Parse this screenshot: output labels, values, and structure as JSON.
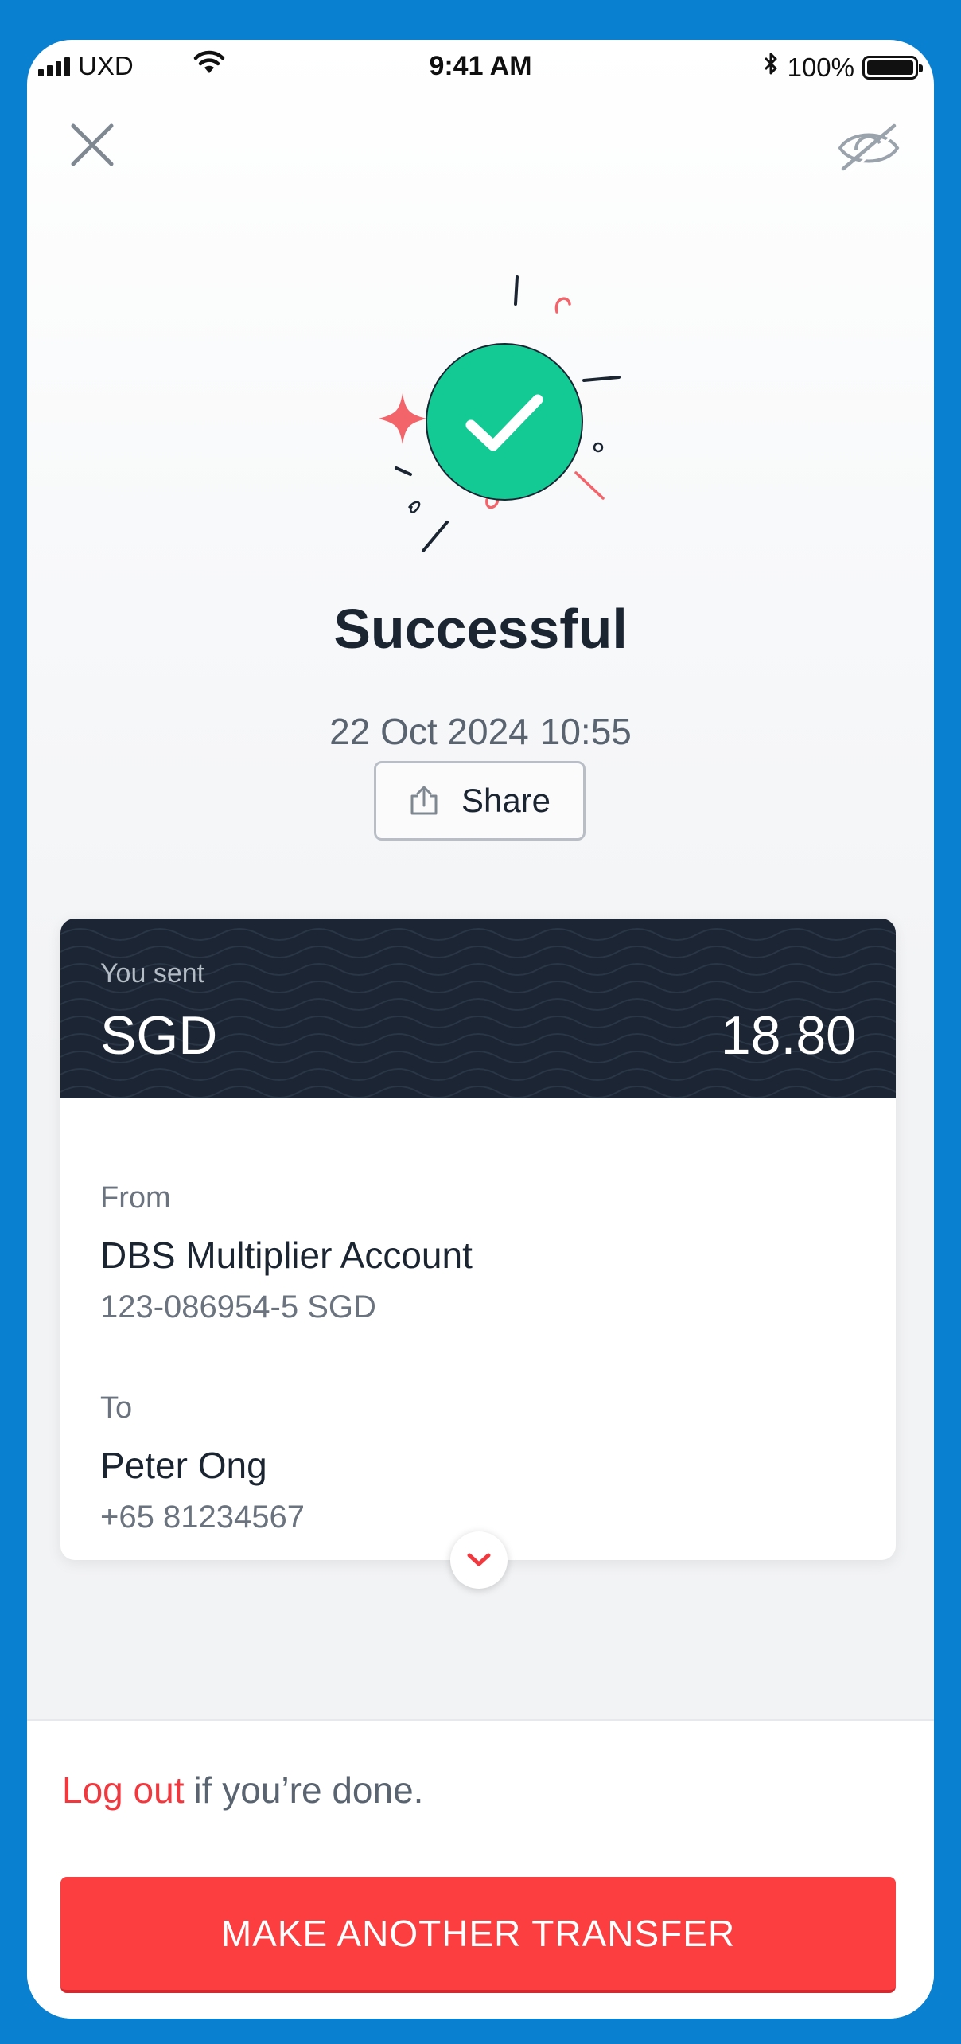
{
  "status_bar": {
    "carrier": "UXD",
    "time": "9:41 AM",
    "battery": "100%",
    "icons": [
      "signal-bars-icon",
      "wifi-icon",
      "bluetooth-icon",
      "battery-icon"
    ]
  },
  "header": {
    "close_icon": "close-icon",
    "hide_icon": "eye-slash-icon"
  },
  "result": {
    "title": "Successful",
    "date": "22 Oct 2024",
    "time": "10:55",
    "share_label": "Share",
    "share_icon": "share-icon",
    "hero_icon": "check-circle-icon",
    "hero_color": "#13c994"
  },
  "transfer": {
    "sent_label": "You sent",
    "currency": "SGD",
    "amount": "18.80",
    "from_label": "From",
    "from_name": "DBS Multiplier Account",
    "from_account": "123-086954-5 SGD",
    "to_label": "To",
    "to_name": "Peter Ong",
    "to_phone": "+65 81234567",
    "expand_icon": "chevron-down-icon"
  },
  "footer": {
    "logout_link": "Log out",
    "logout_suffix": "if you’re done.",
    "cta_label": "MAKE ANOTHER TRANSFER"
  },
  "colors": {
    "frame": "#0a80d0",
    "accent_red": "#fc3e40",
    "card_header": "#1c2533",
    "success_green": "#13c994"
  }
}
